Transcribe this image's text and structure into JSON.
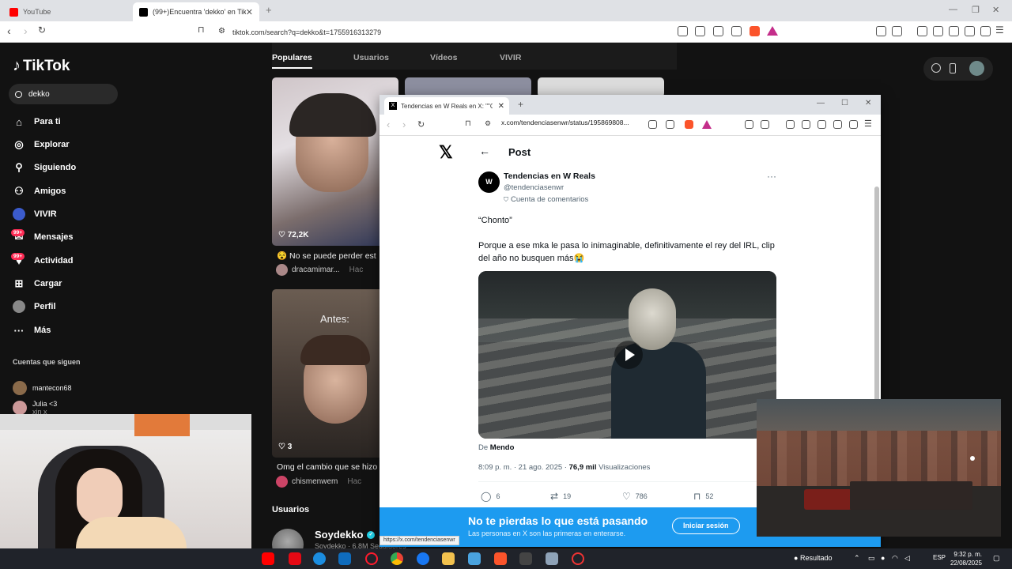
{
  "browser": {
    "tabs": [
      {
        "title": "YouTube",
        "color": "#ff0000"
      },
      {
        "title": "(99+)Encuentra 'dekko' en TikTok",
        "color": "#000000"
      }
    ],
    "url": "tiktok.com/search?q=dekko&t=1755916313279"
  },
  "tiktok": {
    "logo": "TikTok",
    "search_value": "dekko",
    "nav": [
      {
        "label": "Para ti",
        "icon": "home-icon"
      },
      {
        "label": "Explorar",
        "icon": "compass-icon"
      },
      {
        "label": "Siguiendo",
        "icon": "following-icon"
      },
      {
        "label": "Amigos",
        "icon": "friends-icon"
      },
      {
        "label": "VIVIR",
        "icon": "live-icon"
      },
      {
        "label": "Mensajes",
        "icon": "messages-icon",
        "badge": "99+"
      },
      {
        "label": "Actividad",
        "icon": "activity-icon",
        "badge": "99+"
      },
      {
        "label": "Cargar",
        "icon": "upload-icon"
      },
      {
        "label": "Perfil",
        "icon": "profile-icon"
      },
      {
        "label": "Más",
        "icon": "more-icon"
      }
    ],
    "following_header": "Cuentas que siguen",
    "following": [
      {
        "name": "mantecon68"
      },
      {
        "name": "Julia <3",
        "sub": "xin x"
      }
    ],
    "tabs": [
      "Populares",
      "Usuarios",
      "Vídeos",
      "VIVIR"
    ],
    "videos": [
      {
        "likes": "72,2K",
        "caption": "😵 No se puede perder est",
        "author": "dracamimar...",
        "ago": "Hac"
      },
      {
        "likes": "3",
        "caption": "Omg el cambio que se hizo",
        "author": "chismenwem",
        "ago": "Hac",
        "overlay_text": "Antes:"
      }
    ],
    "users_header": "Usuarios",
    "user": {
      "name": "Soydekko",
      "sub": "Soydekko · 6,8M Seguidores"
    }
  },
  "xwindow": {
    "tab_title": "Tendencias en W Reals en X: \"\"C",
    "url": "x.com/tendenciasenwr/status/195869808...",
    "post_title": "Post",
    "author_name": "Tendencias en W Reals",
    "author_handle": "@tendenciasenwr",
    "author_note": "Cuenta de comentarios",
    "avatar_text": "W",
    "text_line1": "“Chonto”",
    "text_line2": "Porque a ese mka le pasa lo inimaginable, definitivamente el rey del IRL, clip del año no busquen más😭",
    "from_label": "De",
    "from_name": "Mendo",
    "timestamp": "8:09 p. m. · 21 ago. 2025 ·",
    "views": "76,9 mil",
    "views_label": "Visualizaciones",
    "replies": "6",
    "reposts": "19",
    "likes": "786",
    "bookmarks": "52",
    "banner_title": "No te pierdas lo que está pasando",
    "banner_sub": "Las personas en X son las primeras en enterarse.",
    "login_label": "Iniciar sesión",
    "status_url": "https://x.com/tendenciasenwr"
  },
  "taskbar": {
    "weather": "Resultado",
    "lang": "ESP",
    "time": "9:32 p. m.",
    "date": "22/08/2025"
  }
}
